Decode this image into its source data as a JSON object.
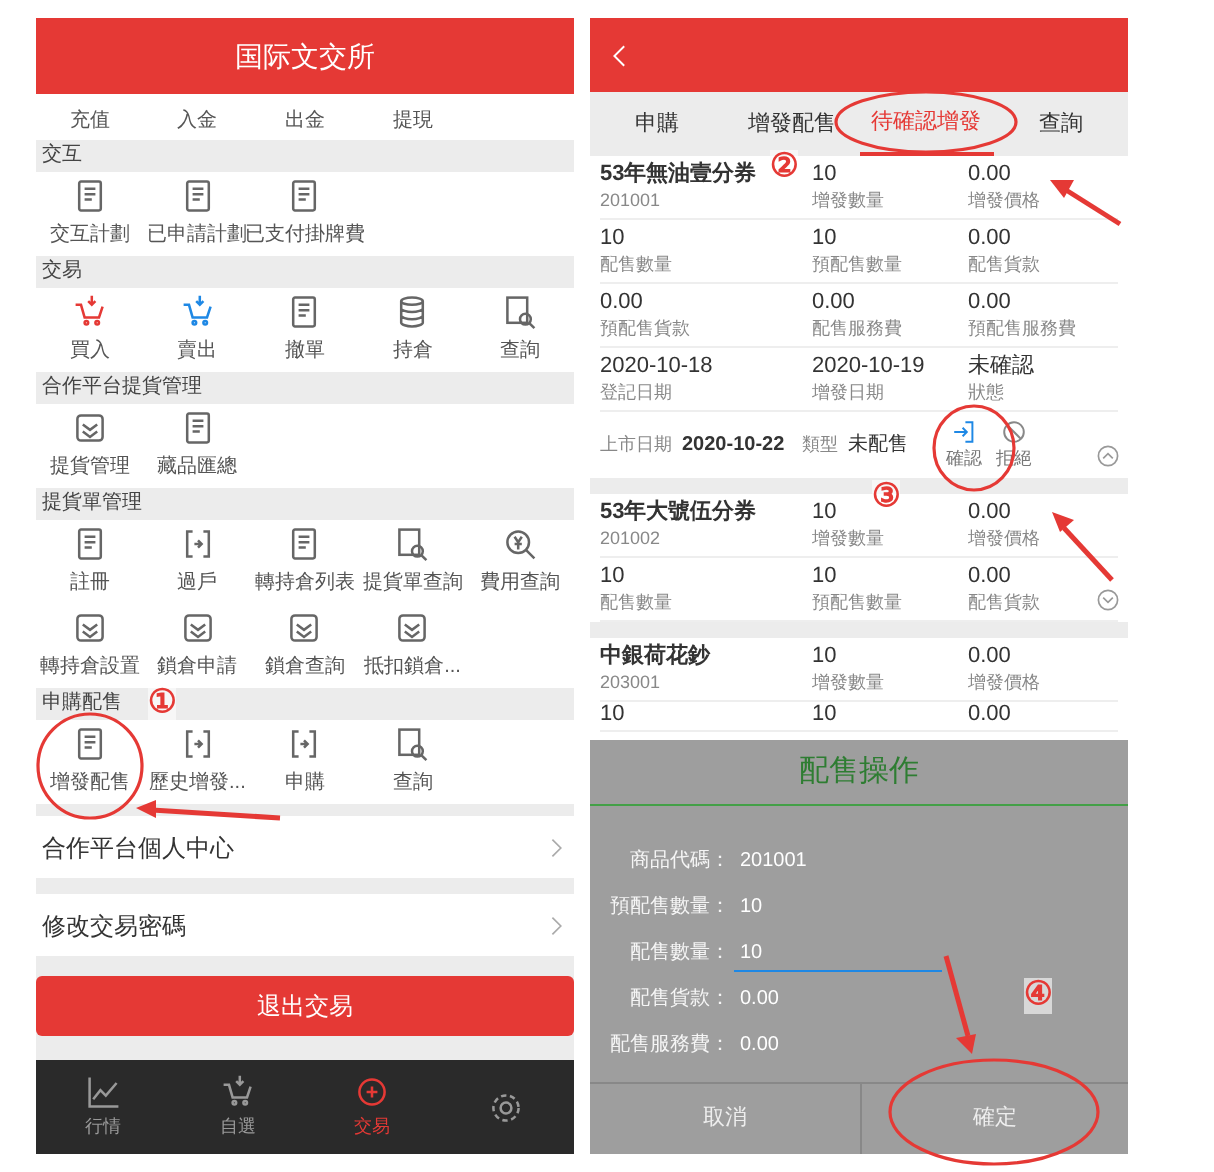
{
  "left_screen": {
    "title": "国际文交所",
    "top_row": [
      "充值",
      "入金",
      "出金",
      "提現"
    ],
    "sections": [
      {
        "header": "交互",
        "items": [
          "交互計劃",
          "已申請計劃",
          "已支付掛牌費"
        ]
      },
      {
        "header": "交易",
        "items": [
          "買入",
          "賣出",
          "撤單",
          "持倉",
          "查詢"
        ]
      },
      {
        "header": "合作平台提貨管理",
        "items": [
          "提貨管理",
          "藏品匯總"
        ]
      },
      {
        "header": "提貨單管理",
        "items": [
          "註冊",
          "過戶",
          "轉持倉列表",
          "提貨單查詢",
          "費用查詢",
          "轉持倉設置",
          "鎖倉申請",
          "鎖倉查詢",
          "抵扣鎖倉..."
        ]
      },
      {
        "header": "申購配售",
        "items": [
          "增發配售",
          "歷史增發...",
          "申購",
          "查詢"
        ]
      }
    ],
    "menu_rows": [
      "合作平台個人中心",
      "修改交易密碼"
    ],
    "exit_button": "退出交易",
    "bottom_nav": [
      {
        "label": "行情",
        "selected": false
      },
      {
        "label": "自選",
        "selected": false
      },
      {
        "label": "交易",
        "selected": true
      },
      {
        "selected": false
      }
    ]
  },
  "right_screen": {
    "tabs": [
      {
        "label": "申購",
        "selected": false
      },
      {
        "label": "增發配售",
        "selected": false
      },
      {
        "label": "待確認增發",
        "selected": true
      },
      {
        "label": "查詢",
        "selected": false
      }
    ],
    "items": [
      {
        "expanded": true,
        "rows": [
          [
            {
              "value": "53年無油壹分券",
              "label": "201001"
            },
            {
              "value": "10",
              "label": "增發數量"
            },
            {
              "value": "0.00",
              "label": "增發價格"
            }
          ],
          [
            {
              "value": "10",
              "label": "配售數量"
            },
            {
              "value": "10",
              "label": "預配售數量"
            },
            {
              "value": "0.00",
              "label": "配售貨款"
            }
          ],
          [
            {
              "value": "0.00",
              "label": "預配售貨款"
            },
            {
              "value": "0.00",
              "label": "配售服務費"
            },
            {
              "value": "0.00",
              "label": "預配售服務費"
            }
          ],
          [
            {
              "value": "2020-10-18",
              "label": "登記日期"
            },
            {
              "value": "2020-10-19",
              "label": "增發日期"
            },
            {
              "value": "未確認",
              "label": "狀態"
            }
          ]
        ],
        "detail": {
          "list_date_label": "上市日期",
          "list_date": "2020-10-22",
          "type_label": "類型",
          "type": "未配售",
          "actions": [
            {
              "label": "確認",
              "kind": "confirm"
            },
            {
              "label": "拒絕",
              "kind": "reject"
            }
          ]
        }
      },
      {
        "expanded": false,
        "rows": [
          [
            {
              "value": "53年大號伍分券",
              "label": "201002"
            },
            {
              "value": "10",
              "label": "增發數量"
            },
            {
              "value": "0.00",
              "label": "增發價格"
            }
          ],
          [
            {
              "value": "10",
              "label": "配售數量"
            },
            {
              "value": "10",
              "label": "預配售數量"
            },
            {
              "value": "0.00",
              "label": "配售貨款"
            }
          ]
        ]
      },
      {
        "rows": [
          [
            {
              "value": "中銀荷花鈔",
              "label": "203001"
            },
            {
              "value": "10",
              "label": "增發數量"
            },
            {
              "value": "0.00",
              "label": "增發價格"
            }
          ],
          [
            {
              "value": "10"
            },
            {
              "value": "10"
            },
            {
              "value": "0.00"
            }
          ]
        ]
      }
    ],
    "dialog": {
      "title": "配售操作",
      "fields": [
        {
          "label": "商品代碼：",
          "value": "201001",
          "kind": "text"
        },
        {
          "label": "預配售數量：",
          "value": "10",
          "kind": "text"
        },
        {
          "label": "配售數量：",
          "value": "10",
          "kind": "input"
        },
        {
          "label": "配售貨款：",
          "value": "0.00",
          "kind": "text"
        },
        {
          "label": "配售服務費：",
          "value": "0.00",
          "kind": "text"
        }
      ],
      "buttons": [
        "取消",
        "確定"
      ]
    }
  },
  "annotations": [
    "①",
    "②",
    "③",
    "④"
  ]
}
